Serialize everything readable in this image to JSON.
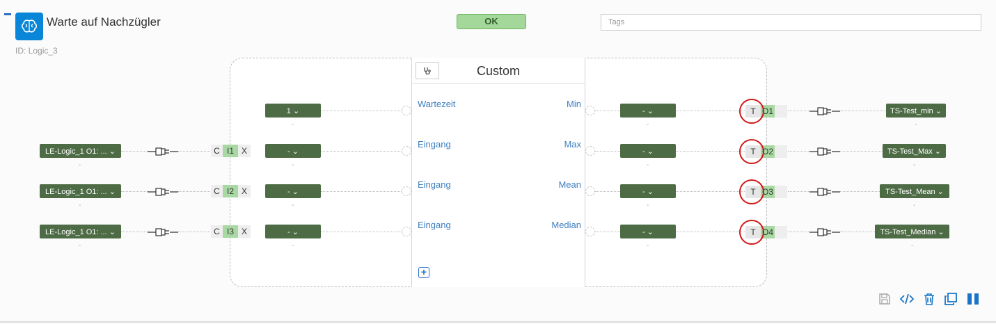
{
  "header": {
    "title": "Warte auf Nachzügler",
    "id_label": "ID: Logic_3",
    "status": "OK",
    "tags_placeholder": "Tags"
  },
  "block": {
    "title": "Custom",
    "add_param_glyph": "+",
    "params_left": [
      "Wartezeit",
      "Eingang",
      "Eingang",
      "Eingang"
    ],
    "params_right": [
      "Min",
      "Max",
      "Mean",
      "Median"
    ]
  },
  "inputs": [
    {
      "source": "",
      "c": "",
      "port": "",
      "x": "",
      "value": "1 ⌄",
      "sub": "-"
    },
    {
      "source": "LE-Logic_1 O1: ... ⌄",
      "source_sub": "-",
      "c": "C",
      "port": "I1",
      "x": "X",
      "value": "- ⌄",
      "sub": "-"
    },
    {
      "source": "LE-Logic_1 O1: ... ⌄",
      "source_sub": "-",
      "c": "C",
      "port": "I2",
      "x": "X",
      "value": "- ⌄",
      "sub": "-"
    },
    {
      "source": "LE-Logic_1 O1: ... ⌄",
      "source_sub": "-",
      "c": "C",
      "port": "I3",
      "x": "X",
      "value": "- ⌄",
      "sub": "-"
    }
  ],
  "outputs": [
    {
      "value": "- ⌄",
      "sub": "-",
      "t": "T",
      "port": "O1",
      "target": "TS-Test_min ⌄",
      "target_sub": "-"
    },
    {
      "value": "- ⌄",
      "sub": "-",
      "t": "T",
      "port": "O2",
      "target": "TS-Test_Max ⌄",
      "target_sub": "-"
    },
    {
      "value": "- ⌄",
      "sub": "-",
      "t": "T",
      "port": "O3",
      "target": "TS-Test_Mean ⌄",
      "target_sub": "-"
    },
    {
      "value": "- ⌄",
      "sub": "-",
      "t": "T",
      "port": "O4",
      "target": "TS-Test_Median ⌄",
      "target_sub": "-"
    }
  ],
  "toolbar": {
    "icons": [
      "save-icon",
      "code-icon",
      "trash-icon",
      "copy-icon",
      "pause-icon"
    ]
  },
  "colors": {
    "accent": "#0a86d8",
    "pill": "#4d6b45",
    "status_bg": "#a4d89a",
    "port_green": "#a9d9a3",
    "annotation_red": "#d01818",
    "link_blue": "#3d7fbf"
  }
}
